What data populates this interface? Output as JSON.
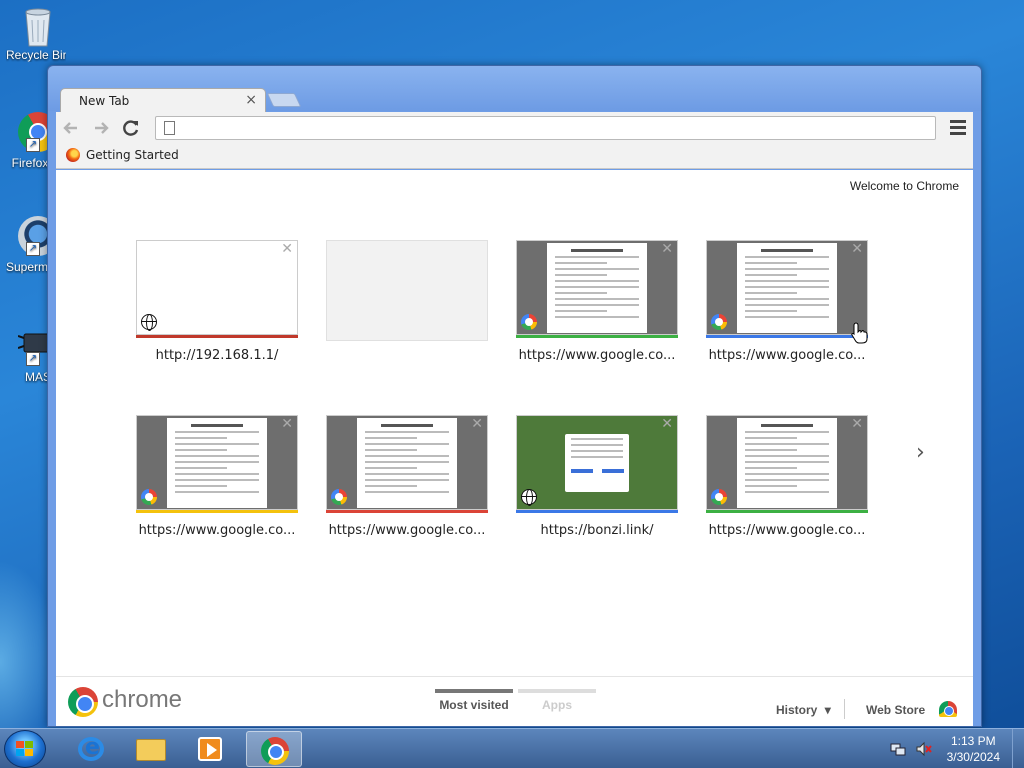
{
  "desktop": {
    "icons": [
      {
        "name": "recycle-bin",
        "label": "Recycle Bin"
      },
      {
        "name": "firefox",
        "label": "Firefox"
      },
      {
        "name": "supermium",
        "label": "Supermium"
      },
      {
        "name": "mas",
        "label": "MAS"
      }
    ]
  },
  "browser": {
    "tab_title": "New Tab",
    "tab_close": "×",
    "omnibox_value": "",
    "bookmarks": [
      {
        "label": "Getting Started",
        "icon": "firefox-icon"
      }
    ],
    "welcome_text": "Welcome to Chrome",
    "most_visited": [
      {
        "label": "http://192.168.1.1/",
        "kind": "blank",
        "favicon": "globe-icon",
        "strip_color": "#c0392b"
      },
      {
        "label": "",
        "kind": "empty",
        "favicon": "",
        "strip_color": ""
      },
      {
        "label": "https://www.google.co...",
        "kind": "google",
        "favicon": "google-icon",
        "strip_color": "#3cb043"
      },
      {
        "label": "https://www.google.co...",
        "kind": "google",
        "favicon": "google-icon",
        "strip_color": "#3b78e7"
      },
      {
        "label": "https://www.google.co...",
        "kind": "google",
        "favicon": "google-icon",
        "strip_color": "#f4c20d"
      },
      {
        "label": "https://www.google.co...",
        "kind": "google",
        "favicon": "google-icon",
        "strip_color": "#db4437"
      },
      {
        "label": "https://bonzi.link/",
        "kind": "bonzi",
        "favicon": "globe-icon",
        "strip_color": "#3b78e7"
      },
      {
        "label": "https://www.google.co...",
        "kind": "google",
        "favicon": "google-icon",
        "strip_color": "#3cb043"
      }
    ],
    "next_arrow": "›",
    "footer": {
      "brand": "chrome",
      "tab_most_visited": "Most visited",
      "tab_apps": "Apps",
      "history": "History",
      "history_caret": "▾",
      "web_store": "Web Store"
    }
  },
  "taskbar": {
    "clock_time": "1:13 PM",
    "clock_date": "3/30/2024"
  }
}
